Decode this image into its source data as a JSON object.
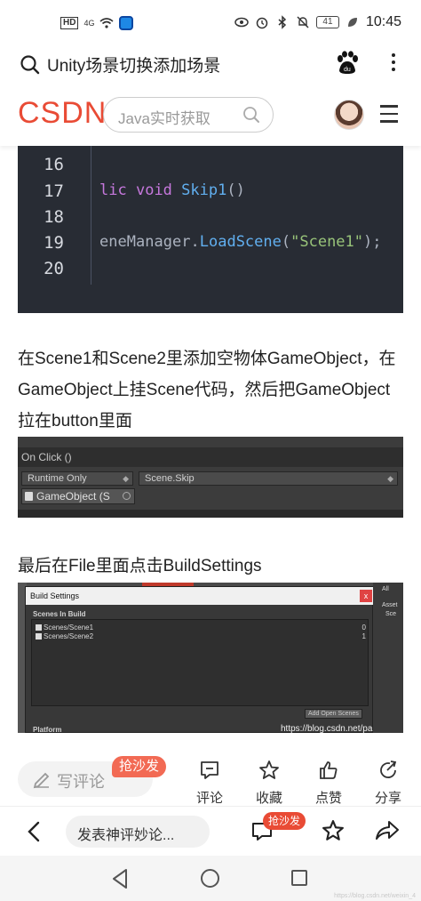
{
  "status_bar": {
    "hd": "HD",
    "signal": "4G",
    "battery": "41",
    "time": "10:45"
  },
  "search_header": {
    "title": "Unity场景切换添加场景",
    "icons": [
      "search-icon",
      "baidu-paw-icon",
      "more-vertical-icon"
    ]
  },
  "csdn_header": {
    "logo": "CSDN",
    "search_placeholder": "Java实时获取"
  },
  "code": {
    "lines": [
      {
        "num": "16",
        "text": ""
      },
      {
        "num": "17",
        "text": "lic void Skip1()"
      },
      {
        "num": "18",
        "text": ""
      },
      {
        "num": "19",
        "text": "eneManager.LoadScene(\"Scene1\");"
      },
      {
        "num": "20",
        "text": ""
      }
    ]
  },
  "article": {
    "para1": "在Scene1和Scene2里添加空物体GameObject，在GameObject上挂Scene代码，然后把GameObject拉在button里面",
    "para2": "最后在File里面点击BuildSettings"
  },
  "unity_inspector": {
    "header": "On Click ()",
    "runtime": "Runtime Only",
    "method": "Scene.Skip",
    "object": "GameObject (S"
  },
  "build_settings": {
    "title": "Build Settings",
    "close": "x",
    "scenes_label": "Scenes In Build",
    "scenes": [
      {
        "name": "Scenes/Scene1",
        "index": "0"
      },
      {
        "name": "Scenes/Scene2",
        "index": "1"
      }
    ],
    "add_button": "Add Open Scenes",
    "platform_label": "Platform",
    "watermark": "https://blog.csdn.net/panghuyou",
    "side_labels": [
      "All",
      "Asset",
      "Sce"
    ]
  },
  "actions": {
    "comment_placeholder": "写评论",
    "sofa_badge": "抢沙发",
    "comment": "评论",
    "favorite": "收藏",
    "like": "点赞",
    "share": "分享"
  },
  "browser_bar": {
    "input_text": "发表神评妙论...",
    "badge": "抢沙发"
  },
  "nav": {
    "watermark": "https://blog.csdn.net/weixin_4"
  }
}
